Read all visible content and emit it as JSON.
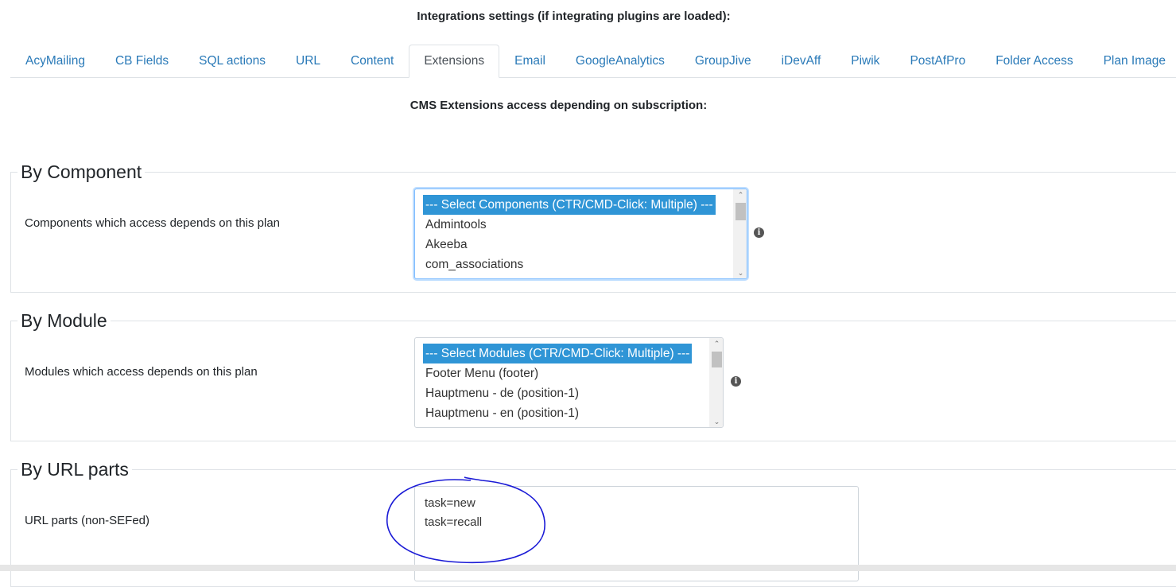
{
  "integrations_heading": "Integrations settings (if integrating plugins are loaded):",
  "tabs": [
    {
      "label": "AcyMailing",
      "active": false
    },
    {
      "label": "CB Fields",
      "active": false
    },
    {
      "label": "SQL actions",
      "active": false
    },
    {
      "label": "URL",
      "active": false
    },
    {
      "label": "Content",
      "active": false
    },
    {
      "label": "Extensions",
      "active": true
    },
    {
      "label": "Email",
      "active": false
    },
    {
      "label": "GoogleAnalytics",
      "active": false
    },
    {
      "label": "GroupJive",
      "active": false
    },
    {
      "label": "iDevAff",
      "active": false
    },
    {
      "label": "Piwik",
      "active": false
    },
    {
      "label": "PostAfPro",
      "active": false
    },
    {
      "label": "Folder Access",
      "active": false
    },
    {
      "label": "Plan Image",
      "active": false
    }
  ],
  "cms_heading": "CMS Extensions access depending on subscription:",
  "by_component": {
    "legend": "By Component",
    "label": "Components which access depends on this plan",
    "options": [
      "--- Select Components (CTR/CMD-Click: Multiple) ---",
      "Admintools",
      "Akeeba",
      "com_associations"
    ],
    "selected_index": 0
  },
  "by_module": {
    "legend": "By Module",
    "label": "Modules which access depends on this plan",
    "options": [
      "--- Select Modules (CTR/CMD-Click: Multiple) ---",
      "Footer Menu (footer)",
      "Hauptmenu - de (position-1)",
      "Hauptmenu - en (position-1)"
    ],
    "selected_index": 0
  },
  "by_url": {
    "legend": "By URL parts",
    "label": "URL parts (non-SEFed)",
    "lines": [
      "task=new",
      "task=recall"
    ]
  },
  "icons": {
    "info": "info-icon",
    "scroll_up": "chevron-up-icon",
    "scroll_down": "chevron-down-icon"
  },
  "colors": {
    "link": "#2a7ab8",
    "selected_option": "#2f95d6",
    "annotation": "#1a1ad6"
  }
}
